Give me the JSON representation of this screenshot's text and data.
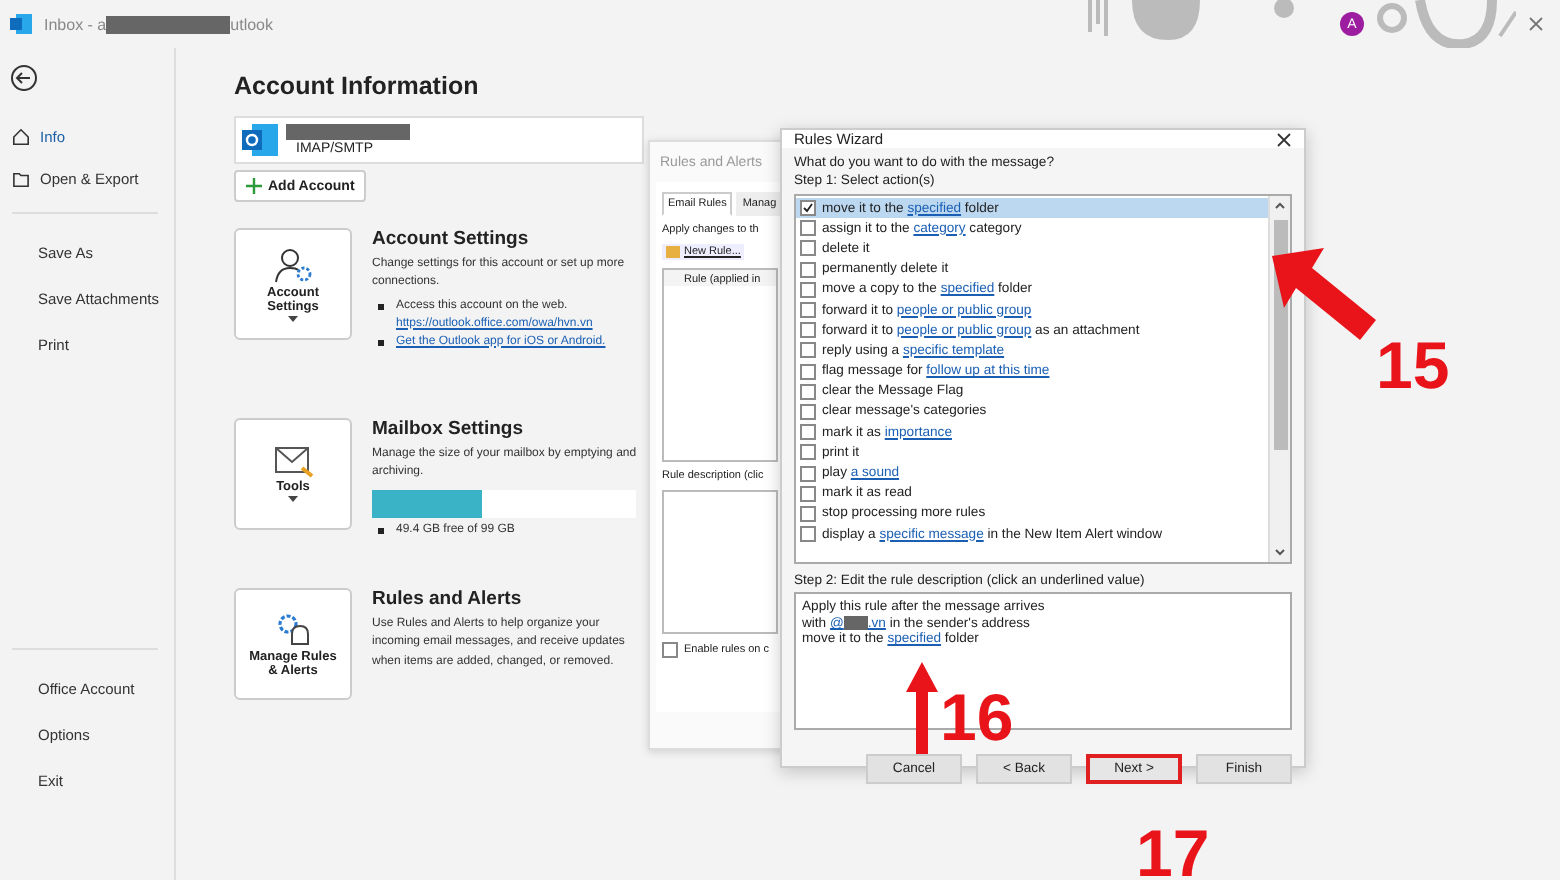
{
  "window": {
    "title_start": "Inbox - a",
    "title_end": "utlook",
    "avatar": "A"
  },
  "sidebar": {
    "nav": [
      {
        "label": "Info",
        "selected": true
      },
      {
        "label": "Open & Export",
        "selected": false
      }
    ],
    "commands": [
      "Save As",
      "Save Attachments",
      "Print"
    ],
    "footer": [
      "Office Account",
      "Options",
      "Exit"
    ]
  },
  "page": {
    "title": "Account Information",
    "account_type": "IMAP/SMTP",
    "add_account": "Add Account",
    "cards": [
      {
        "kind": "account",
        "button_label": "Account Settings",
        "dropdown": true,
        "title": "Account Settings",
        "description": "Change settings for this account or set up more connections.",
        "bullets": [
          {
            "text": "Access this account on the web.",
            "link": "https://outlook.office.com/owa/hvn.vn"
          },
          {
            "link": "Get the Outlook app for iOS or Android."
          }
        ]
      },
      {
        "kind": "mailbox",
        "button_label": "Tools",
        "dropdown": true,
        "title": "Mailbox Settings",
        "description": "Manage the size of your mailbox by emptying and archiving.",
        "level": 0.42,
        "bullets": [
          {
            "text": "49.4 GB free of 99 GB"
          }
        ]
      },
      {
        "kind": "rules",
        "button_label": "Manage Rules & Alerts",
        "dropdown": false,
        "title": "Rules and Alerts",
        "description": "Use Rules and Alerts to help organize your incoming email messages, and receive updates when items are added, changed, or removed."
      }
    ]
  },
  "rules_alerts": {
    "title": "Rules and Alerts",
    "tabs": [
      {
        "label": "Email Rules",
        "selected": true
      },
      {
        "label": "Manag",
        "selected": false
      }
    ],
    "apply_label": "Apply changes to th",
    "new_rule": "New Rule...",
    "column": "Rule (applied in",
    "description_label": "Rule description (clic",
    "enable_checkbox": {
      "label": "Enable rules on c",
      "checked": false
    }
  },
  "wizard": {
    "title": "Rules Wizard",
    "question": "What do you want to do with the message?",
    "step1": "Step 1: Select action(s)",
    "actions": [
      {
        "checked": true,
        "selected": true,
        "parts": [
          {
            "kind": "text",
            "text": "move it to the "
          },
          {
            "kind": "link",
            "text": "specified"
          },
          {
            "kind": "text",
            "text": " folder"
          }
        ]
      },
      {
        "checked": false,
        "selected": false,
        "parts": [
          {
            "kind": "text",
            "text": "assign it to the "
          },
          {
            "kind": "link",
            "text": "category"
          },
          {
            "kind": "text",
            "text": " category"
          }
        ]
      },
      {
        "checked": false,
        "selected": false,
        "parts": [
          {
            "kind": "text",
            "text": "delete it"
          }
        ]
      },
      {
        "checked": false,
        "selected": false,
        "parts": [
          {
            "kind": "text",
            "text": "permanently delete it"
          }
        ]
      },
      {
        "checked": false,
        "selected": false,
        "parts": [
          {
            "kind": "text",
            "text": "move a copy to the "
          },
          {
            "kind": "link",
            "text": "specified"
          },
          {
            "kind": "text",
            "text": " folder"
          }
        ]
      },
      {
        "checked": false,
        "selected": false,
        "parts": [
          {
            "kind": "text",
            "text": "forward it to "
          },
          {
            "kind": "link",
            "text": "people or public group"
          }
        ]
      },
      {
        "checked": false,
        "selected": false,
        "parts": [
          {
            "kind": "text",
            "text": "forward it to "
          },
          {
            "kind": "link",
            "text": "people or public group"
          },
          {
            "kind": "text",
            "text": " as an attachment"
          }
        ]
      },
      {
        "checked": false,
        "selected": false,
        "parts": [
          {
            "kind": "text",
            "text": "reply using a "
          },
          {
            "kind": "link",
            "text": "specific template"
          }
        ]
      },
      {
        "checked": false,
        "selected": false,
        "parts": [
          {
            "kind": "text",
            "text": "flag message for "
          },
          {
            "kind": "link",
            "text": "follow up at this time"
          }
        ]
      },
      {
        "checked": false,
        "selected": false,
        "parts": [
          {
            "kind": "text",
            "text": "clear the Message Flag"
          }
        ]
      },
      {
        "checked": false,
        "selected": false,
        "parts": [
          {
            "kind": "text",
            "text": "clear message's categories"
          }
        ]
      },
      {
        "checked": false,
        "selected": false,
        "parts": [
          {
            "kind": "text",
            "text": "mark it as "
          },
          {
            "kind": "link",
            "text": "importance"
          }
        ]
      },
      {
        "checked": false,
        "selected": false,
        "parts": [
          {
            "kind": "text",
            "text": "print it"
          }
        ]
      },
      {
        "checked": false,
        "selected": false,
        "parts": [
          {
            "kind": "text",
            "text": "play "
          },
          {
            "kind": "link",
            "text": "a sound"
          }
        ]
      },
      {
        "checked": false,
        "selected": false,
        "parts": [
          {
            "kind": "text",
            "text": "mark it as read"
          }
        ]
      },
      {
        "checked": false,
        "selected": false,
        "parts": [
          {
            "kind": "text",
            "text": "stop processing more rules"
          }
        ]
      },
      {
        "checked": false,
        "selected": false,
        "parts": [
          {
            "kind": "text",
            "text": "display a "
          },
          {
            "kind": "link",
            "text": "specific message"
          },
          {
            "kind": "text",
            "text": " in the New Item Alert window"
          }
        ]
      }
    ],
    "step2": "Step 2: Edit the rule description (click an underlined value)",
    "description": [
      [
        {
          "kind": "text",
          "text": "Apply this rule after the message arrives"
        }
      ],
      [
        {
          "kind": "text",
          "text": "with "
        },
        {
          "kind": "link",
          "text": "@"
        },
        {
          "kind": "redacted"
        },
        {
          "kind": "link",
          "text": ".vn"
        },
        {
          "kind": "text",
          "text": " in the sender's address"
        }
      ],
      [
        {
          "kind": "text",
          "text": "move it to the "
        },
        {
          "kind": "link",
          "text": "specified"
        },
        {
          "kind": "text",
          "text": " folder"
        }
      ]
    ],
    "buttons": [
      {
        "label": "Cancel",
        "highlighted": false
      },
      {
        "label": "< Back",
        "highlighted": false
      },
      {
        "label": "Next >",
        "highlighted": true
      },
      {
        "label": "Finish",
        "highlighted": false
      }
    ]
  },
  "annotations": [
    {
      "label": "15",
      "kind": "diagonal-arrow"
    },
    {
      "label": "16",
      "kind": "up-arrow"
    },
    {
      "label": "17",
      "kind": "plain"
    }
  ]
}
